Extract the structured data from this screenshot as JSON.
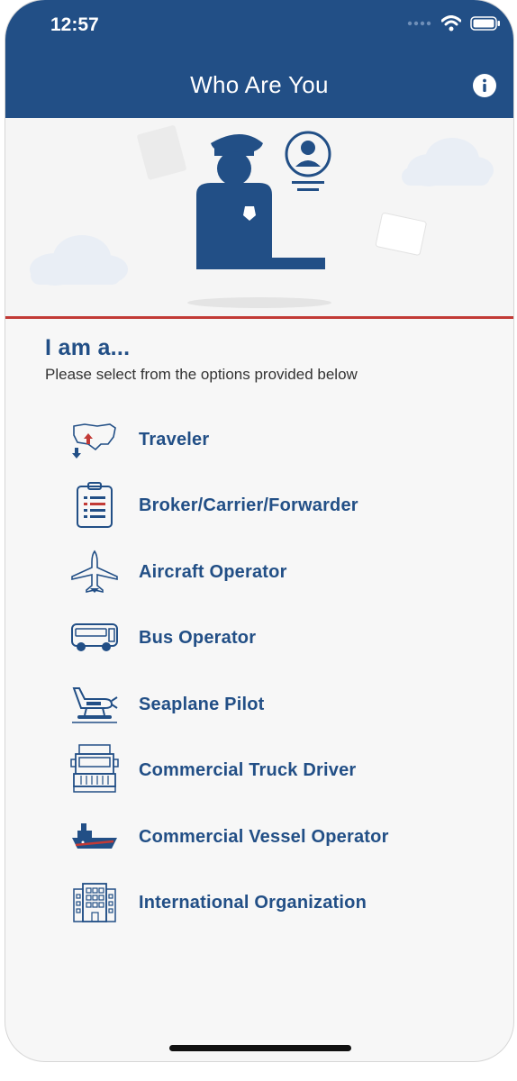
{
  "status_bar": {
    "time": "12:57"
  },
  "header": {
    "title": "Who Are You"
  },
  "intro": {
    "heading": "I am a...",
    "subtitle": "Please select from the options provided below"
  },
  "options": [
    {
      "label": "Traveler",
      "icon": "usa-map-arrows-icon"
    },
    {
      "label": "Broker/Carrier/Forwarder",
      "icon": "clipboard-icon"
    },
    {
      "label": "Aircraft Operator",
      "icon": "airplane-icon"
    },
    {
      "label": "Bus Operator",
      "icon": "bus-icon"
    },
    {
      "label": "Seaplane Pilot",
      "icon": "seaplane-icon"
    },
    {
      "label": "Commercial Truck Driver",
      "icon": "truck-icon"
    },
    {
      "label": "Commercial Vessel Operator",
      "icon": "ship-icon"
    },
    {
      "label": "International Organization",
      "icon": "building-icon"
    }
  ],
  "colors": {
    "brand_blue": "#224f86",
    "accent_red": "#c23a36"
  }
}
